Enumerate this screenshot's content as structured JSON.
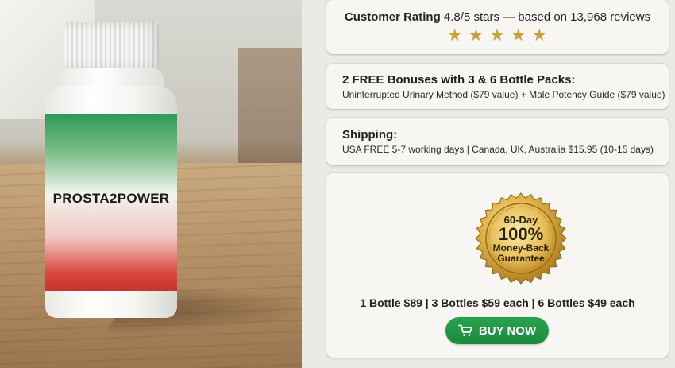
{
  "product": {
    "label": "PROSTA2POWER"
  },
  "rating": {
    "heading": "Customer Rating",
    "score_text": "4.8/5 stars — based on 13,968 reviews",
    "stars": [
      "★",
      "★",
      "★",
      "★",
      "★"
    ],
    "stars_value": 4.8,
    "star_color": "#c9a13a"
  },
  "bonuses": {
    "title": "2 FREE Bonuses with 3 & 6 Bottle Packs:",
    "detail": "Uninterrupted Urinary Method ($79 value) + Male Potency Guide ($79 value)"
  },
  "shipping": {
    "title": "Shipping:",
    "detail": "USA FREE 5-7 working days | Canada, UK, Australia $15.95 (10-15 days)"
  },
  "offer": {
    "seal": {
      "days": "60-Day",
      "percent": "100%",
      "line1": "Money-Back",
      "line2": "Guarantee"
    },
    "prices": "1 Bottle $89 | 3 Bottles $59 each | 6 Bottles $49 each",
    "buy_button": {
      "label": "BUY NOW",
      "icon": "cart-icon",
      "color": "#1e9142"
    }
  }
}
